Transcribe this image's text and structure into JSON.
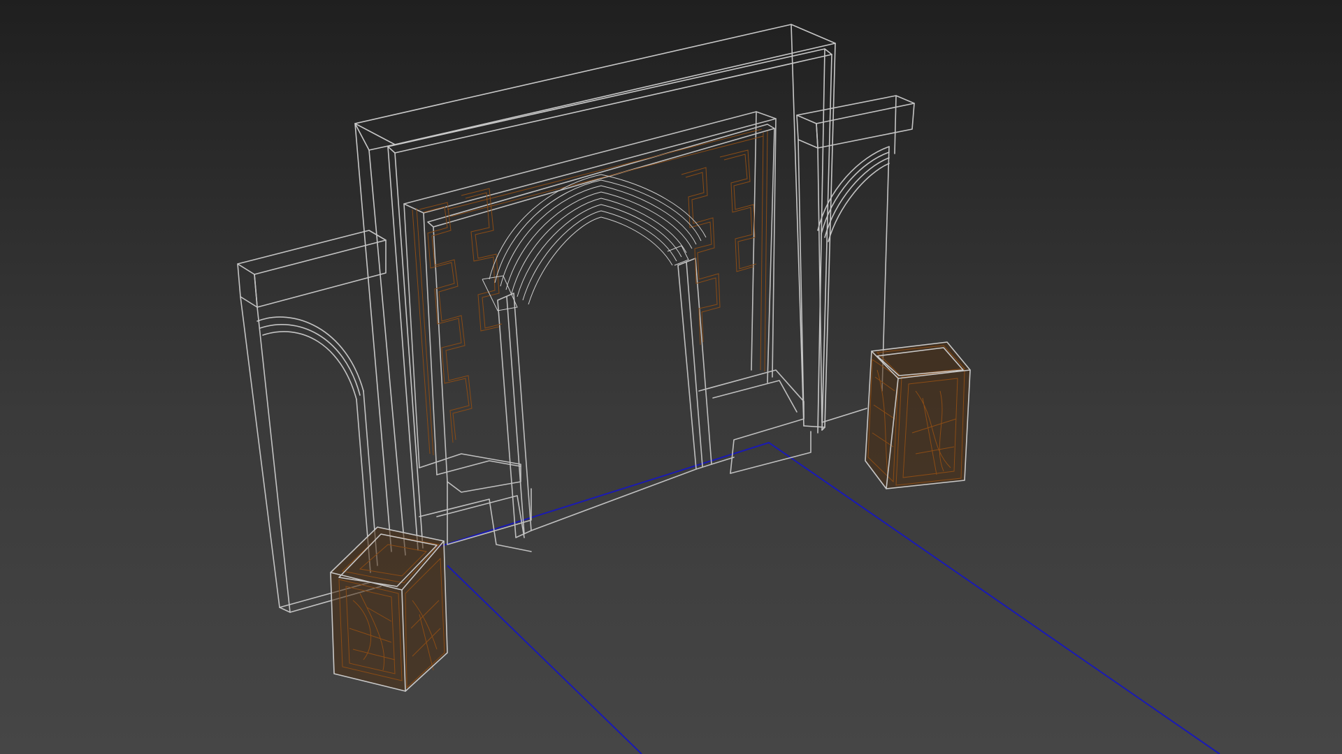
{
  "viewport": {
    "mode": "wireframe",
    "background": "gradient-dark-gray"
  },
  "colors": {
    "wire_structure": "#c8c8c8",
    "wire_ornament": "#8a4c16",
    "wire_lantern_fill": "#5a3614",
    "selection_line": "#1a1ab4"
  },
  "objects": [
    "main-frame",
    "center-arch-panel",
    "right-wing-wall",
    "left-wing-wall",
    "left-lantern",
    "right-lantern",
    "blue-selection-outline"
  ]
}
